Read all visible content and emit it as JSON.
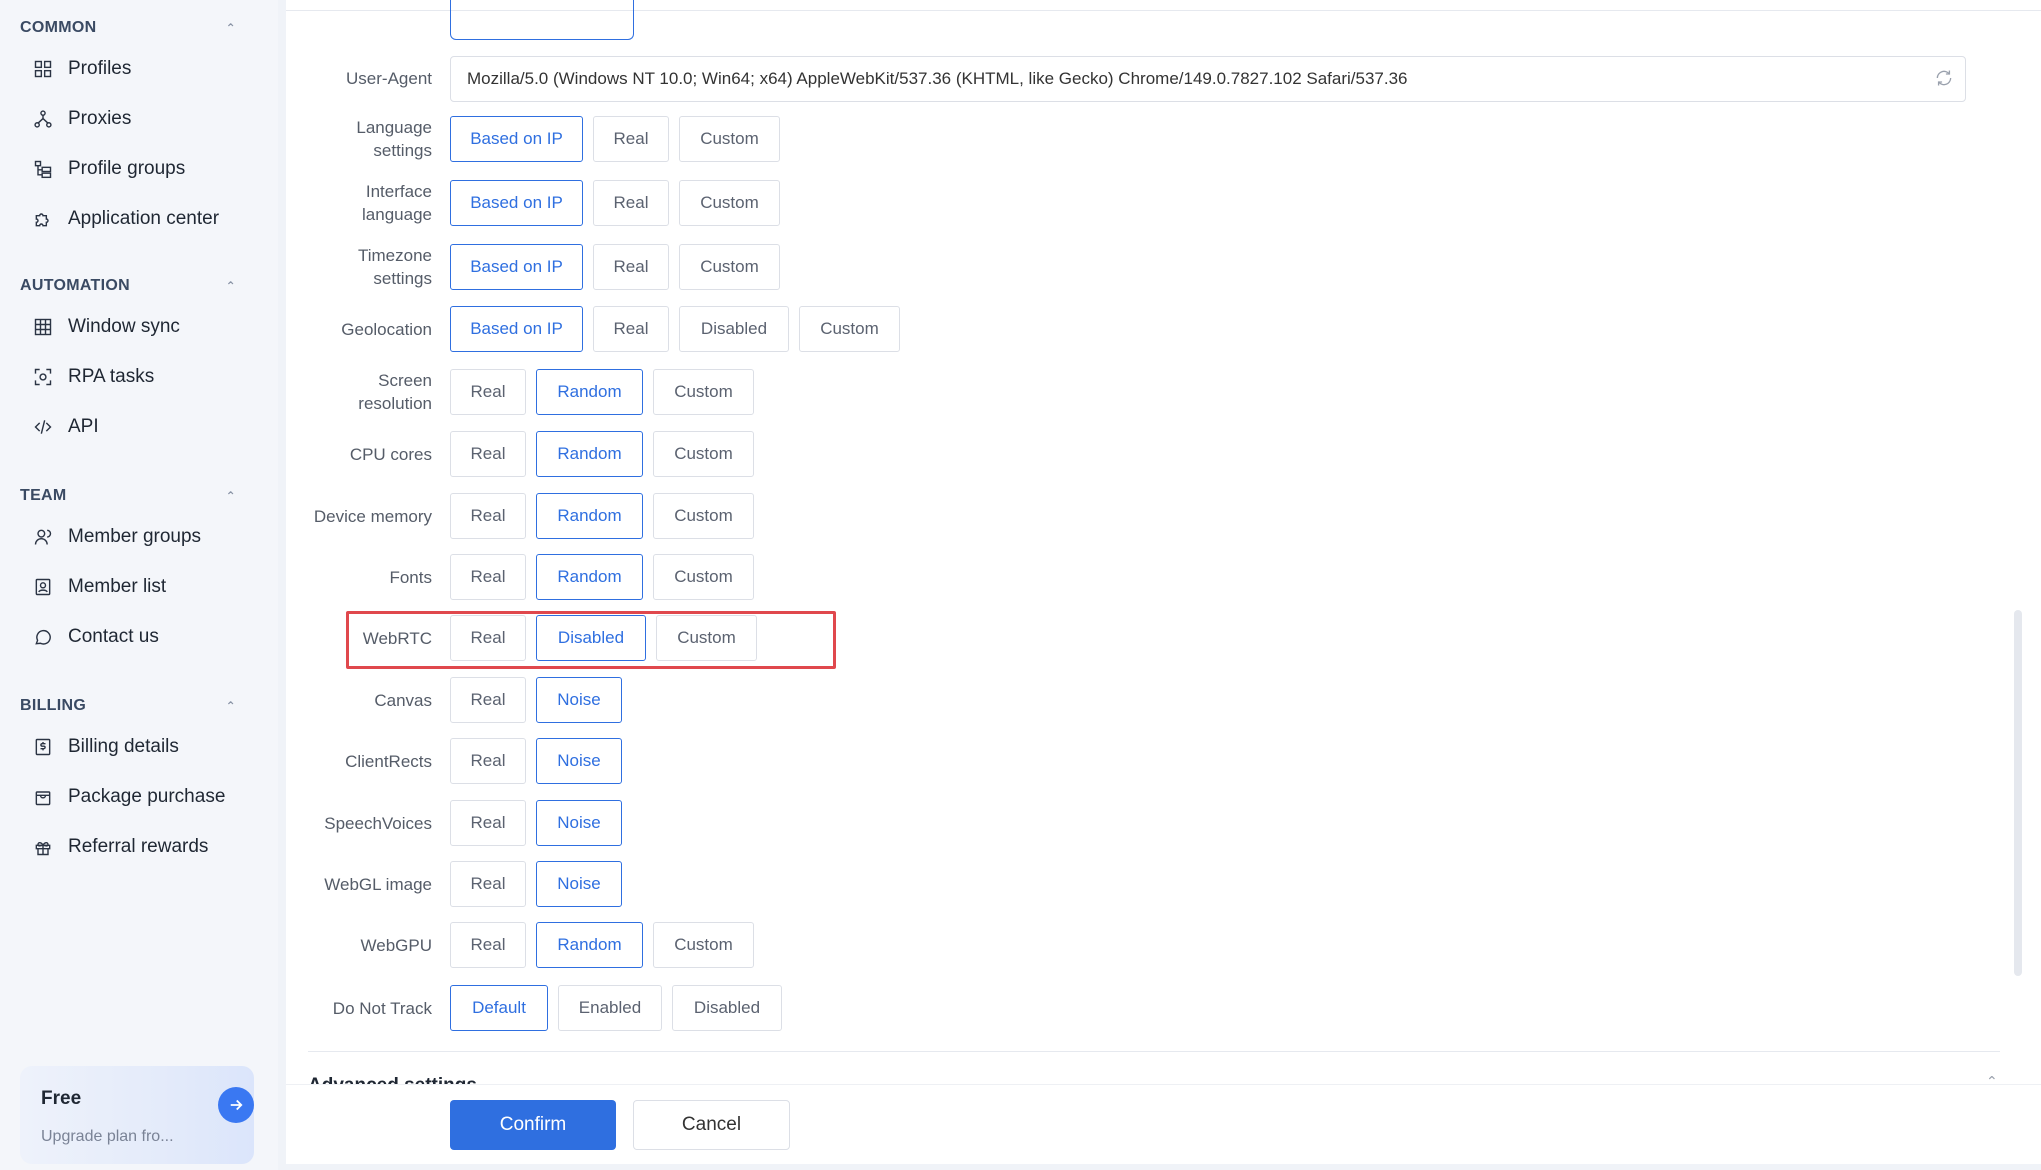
{
  "sidebar": {
    "sections": [
      {
        "title": "COMMON",
        "items": [
          {
            "label": "Profiles",
            "icon": "grid-icon"
          },
          {
            "label": "Proxies",
            "icon": "network-icon"
          },
          {
            "label": "Profile groups",
            "icon": "tree-icon"
          },
          {
            "label": "Application center",
            "icon": "puzzle-icon"
          }
        ]
      },
      {
        "title": "AUTOMATION",
        "items": [
          {
            "label": "Window sync",
            "icon": "table-icon"
          },
          {
            "label": "RPA tasks",
            "icon": "scan-icon"
          },
          {
            "label": "API",
            "icon": "code-icon"
          }
        ]
      },
      {
        "title": "TEAM",
        "items": [
          {
            "label": "Member groups",
            "icon": "users-icon"
          },
          {
            "label": "Member list",
            "icon": "id-card-icon"
          },
          {
            "label": "Contact us",
            "icon": "chat-icon"
          }
        ]
      },
      {
        "title": "BILLING",
        "items": [
          {
            "label": "Billing details",
            "icon": "dollar-doc-icon"
          },
          {
            "label": "Package purchase",
            "icon": "bag-icon"
          },
          {
            "label": "Referral rewards",
            "icon": "gift-icon"
          }
        ]
      }
    ],
    "upgrade": {
      "plan": "Free",
      "text": "Upgrade plan fro..."
    }
  },
  "form": {
    "user_agent": {
      "label": "User-Agent",
      "value": "Mozilla/5.0 (Windows NT 10.0; Win64; x64) AppleWebKit/537.36 (KHTML, like Gecko) Chrome/149.0.7827.102 Safari/537.36"
    },
    "rows": [
      {
        "label": [
          "Language",
          "settings"
        ],
        "options": [
          "Based on IP",
          "Real",
          "Custom"
        ],
        "selected": 0
      },
      {
        "label": [
          "Interface",
          "language"
        ],
        "options": [
          "Based on IP",
          "Real",
          "Custom"
        ],
        "selected": 0
      },
      {
        "label": [
          "Timezone",
          "settings"
        ],
        "options": [
          "Based on IP",
          "Real",
          "Custom"
        ],
        "selected": 0
      },
      {
        "label": [
          "Geolocation"
        ],
        "options": [
          "Based on IP",
          "Real",
          "Disabled",
          "Custom"
        ],
        "selected": 0
      },
      {
        "label": [
          "Screen",
          "resolution"
        ],
        "options": [
          "Real",
          "Random",
          "Custom"
        ],
        "selected": 1
      },
      {
        "label": [
          "CPU cores"
        ],
        "options": [
          "Real",
          "Random",
          "Custom"
        ],
        "selected": 1
      },
      {
        "label": [
          "Device memory"
        ],
        "options": [
          "Real",
          "Random",
          "Custom"
        ],
        "selected": 1
      },
      {
        "label": [
          "Fonts"
        ],
        "options": [
          "Real",
          "Random",
          "Custom"
        ],
        "selected": 1
      },
      {
        "label": [
          "WebRTC"
        ],
        "options": [
          "Real",
          "Disabled",
          "Custom"
        ],
        "selected": 1
      },
      {
        "label": [
          "Canvas"
        ],
        "options": [
          "Real",
          "Noise"
        ],
        "selected": 1
      },
      {
        "label": [
          "ClientRects"
        ],
        "options": [
          "Real",
          "Noise"
        ],
        "selected": 1
      },
      {
        "label": [
          "SpeechVoices"
        ],
        "options": [
          "Real",
          "Noise"
        ],
        "selected": 1
      },
      {
        "label": [
          "WebGL image"
        ],
        "options": [
          "Real",
          "Noise"
        ],
        "selected": 1
      },
      {
        "label": [
          "WebGPU"
        ],
        "options": [
          "Real",
          "Random",
          "Custom"
        ],
        "selected": 1
      },
      {
        "label": [
          "Do Not Track"
        ],
        "options": [
          "Default",
          "Enabled",
          "Disabled"
        ],
        "selected": 0
      }
    ],
    "advanced_label": "Advanced settings"
  },
  "footer": {
    "confirm": "Confirm",
    "cancel": "Cancel"
  },
  "colors": {
    "accent": "#2f6fe0",
    "highlight": "#e0484d"
  }
}
